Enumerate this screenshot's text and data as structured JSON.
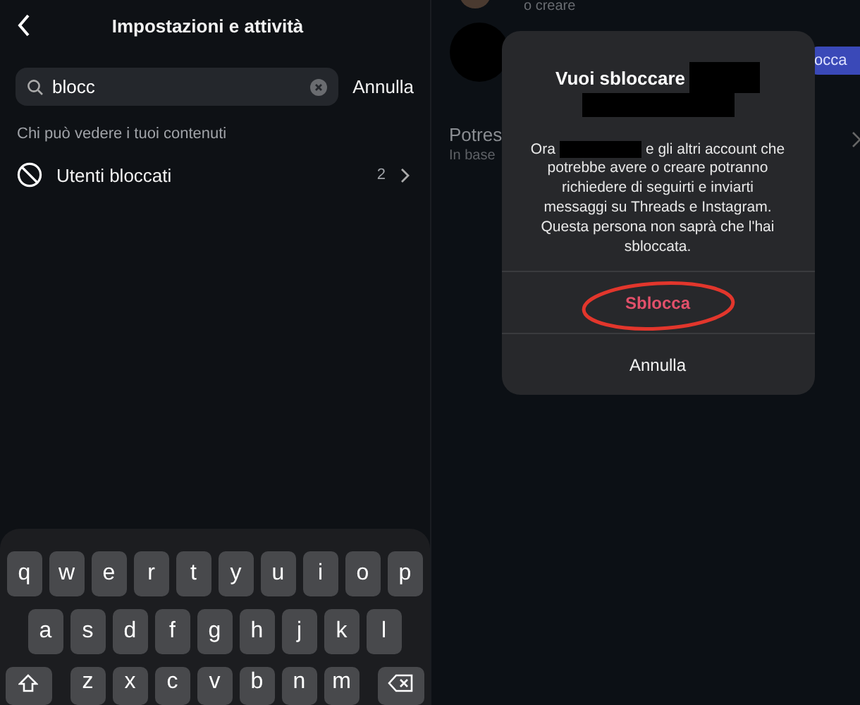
{
  "settings": {
    "title": "Impostazioni e attività",
    "search": {
      "value": "blocc",
      "cancel": "Annulla"
    },
    "section": "Chi può vedere i tuoi contenuti",
    "results": [
      {
        "label": "Utenti bloccati",
        "count": "2"
      }
    ]
  },
  "keyboard": {
    "rows": [
      [
        "q",
        "w",
        "e",
        "r",
        "t",
        "y",
        "u",
        "i",
        "o",
        "p"
      ],
      [
        "a",
        "s",
        "d",
        "f",
        "g",
        "h",
        "j",
        "k",
        "l"
      ],
      [
        "z",
        "x",
        "c",
        "v",
        "b",
        "n",
        "m"
      ]
    ]
  },
  "background": {
    "caption": "o creare",
    "button": "occa",
    "row_title": "Potres",
    "row_subtitle": "In base"
  },
  "dialog": {
    "title": "Vuoi sbloccare",
    "body_start": "Ora",
    "body_first_line": "e gli altri account che",
    "body_rest": "potrebbe avere o creare potranno richiedere di seguirti e inviarti messaggi su Threads e Instagram. Questa persona non saprà che l'hai sbloccata.",
    "actions": [
      {
        "label": "Sblocca",
        "kind": "destructive",
        "circled": true
      },
      {
        "label": "Annulla",
        "kind": "cancel",
        "circled": false
      }
    ]
  }
}
